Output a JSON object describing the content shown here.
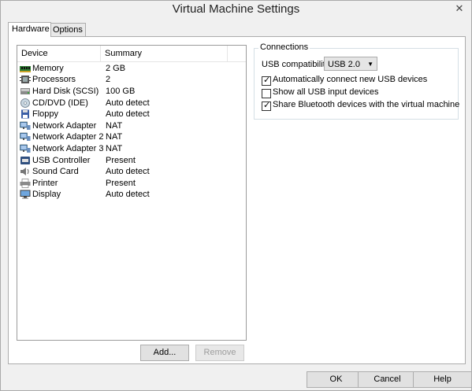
{
  "window": {
    "title": "Virtual Machine Settings"
  },
  "tabs": [
    {
      "label": "Hardware",
      "active": true
    },
    {
      "label": "Options",
      "active": false
    }
  ],
  "device_list": {
    "columns": [
      "Device",
      "Summary"
    ],
    "rows": [
      {
        "icon": "memory-icon",
        "name": "Memory",
        "summary": "2 GB"
      },
      {
        "icon": "processor-icon",
        "name": "Processors",
        "summary": "2"
      },
      {
        "icon": "hard-disk-icon",
        "name": "Hard Disk (SCSI)",
        "summary": "100 GB"
      },
      {
        "icon": "cd-dvd-icon",
        "name": "CD/DVD (IDE)",
        "summary": "Auto detect"
      },
      {
        "icon": "floppy-icon",
        "name": "Floppy",
        "summary": "Auto detect"
      },
      {
        "icon": "network-adapter-icon",
        "name": "Network Adapter",
        "summary": "NAT"
      },
      {
        "icon": "network-adapter-icon",
        "name": "Network Adapter 2",
        "summary": "NAT"
      },
      {
        "icon": "network-adapter-icon",
        "name": "Network Adapter 3",
        "summary": "NAT"
      },
      {
        "icon": "usb-controller-icon",
        "name": "USB Controller",
        "summary": "Present"
      },
      {
        "icon": "sound-card-icon",
        "name": "Sound Card",
        "summary": "Auto detect"
      },
      {
        "icon": "printer-icon",
        "name": "Printer",
        "summary": "Present"
      },
      {
        "icon": "display-icon",
        "name": "Display",
        "summary": "Auto detect"
      }
    ],
    "add_label": "Add...",
    "remove_label": "Remove"
  },
  "connections": {
    "legend": "Connections",
    "usb_compat_label": "USB compatibility:",
    "usb_compat_value": "USB 2.0",
    "options": [
      {
        "label": "Automatically connect new USB devices",
        "checked": true
      },
      {
        "label": "Show all USB input devices",
        "checked": false
      },
      {
        "label": "Share Bluetooth devices with the virtual machine",
        "checked": true
      }
    ]
  },
  "footer": {
    "ok_label": "OK",
    "cancel_label": "Cancel",
    "help_label": "Help"
  }
}
